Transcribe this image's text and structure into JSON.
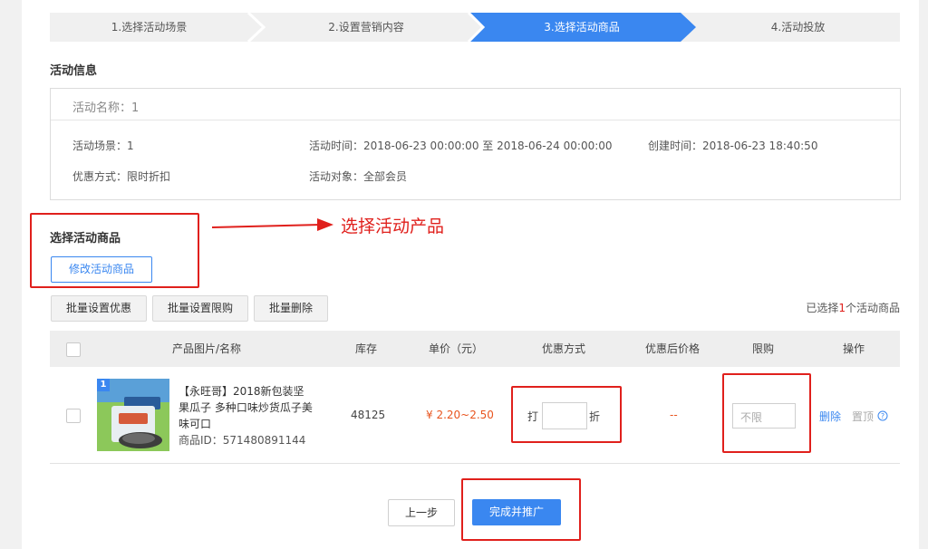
{
  "steps": [
    {
      "label": "1.选择活动场景"
    },
    {
      "label": "2.设置营销内容"
    },
    {
      "label": "3.选择活动商品"
    },
    {
      "label": "4.活动投放"
    }
  ],
  "activity_info": {
    "title": "活动信息",
    "name": "活动名称：1",
    "scene": "活动场景：1",
    "time": "活动时间：2018-06-23 00:00:00 至 2018-06-24 00:00:00",
    "created": "创建时间：2018-06-23 18:40:50",
    "discount_type": "优惠方式：限时折扣",
    "target": "活动对象：全部会员"
  },
  "select_products": {
    "title": "选择活动商品",
    "modify_button": "修改活动商品",
    "annotation": "选择活动产品"
  },
  "bulk_actions": {
    "set_discount": "批量设置优惠",
    "set_limit": "批量设置限购",
    "delete": "批量删除"
  },
  "selected_info": {
    "prefix": "已选择",
    "count": "1",
    "suffix": "个活动商品"
  },
  "table": {
    "headers": {
      "product": "产品图片/名称",
      "stock": "库存",
      "price": "单价（元）",
      "discount": "优惠方式",
      "after_price": "优惠后价格",
      "limit": "限购",
      "ops": "操作"
    },
    "rows": [
      {
        "badge": "1",
        "name": "【永旺哥】2018新包装坚果瓜子 多种口味炒货瓜子美味可口",
        "product_id": "商品ID：571480891144",
        "stock": "48125",
        "price": "¥ 2.20~2.50",
        "discount_prefix": "打",
        "discount_value": "",
        "discount_suffix": "折",
        "after_price": "--",
        "limit_placeholder": "不限",
        "op_delete": "删除",
        "op_top": "置顶"
      }
    ]
  },
  "footer": {
    "prev": "上一步",
    "finish": "完成并推广"
  },
  "colors": {
    "primary": "#3a87f0",
    "annotation_red": "#e0201c",
    "price_orange": "#e8541e"
  }
}
